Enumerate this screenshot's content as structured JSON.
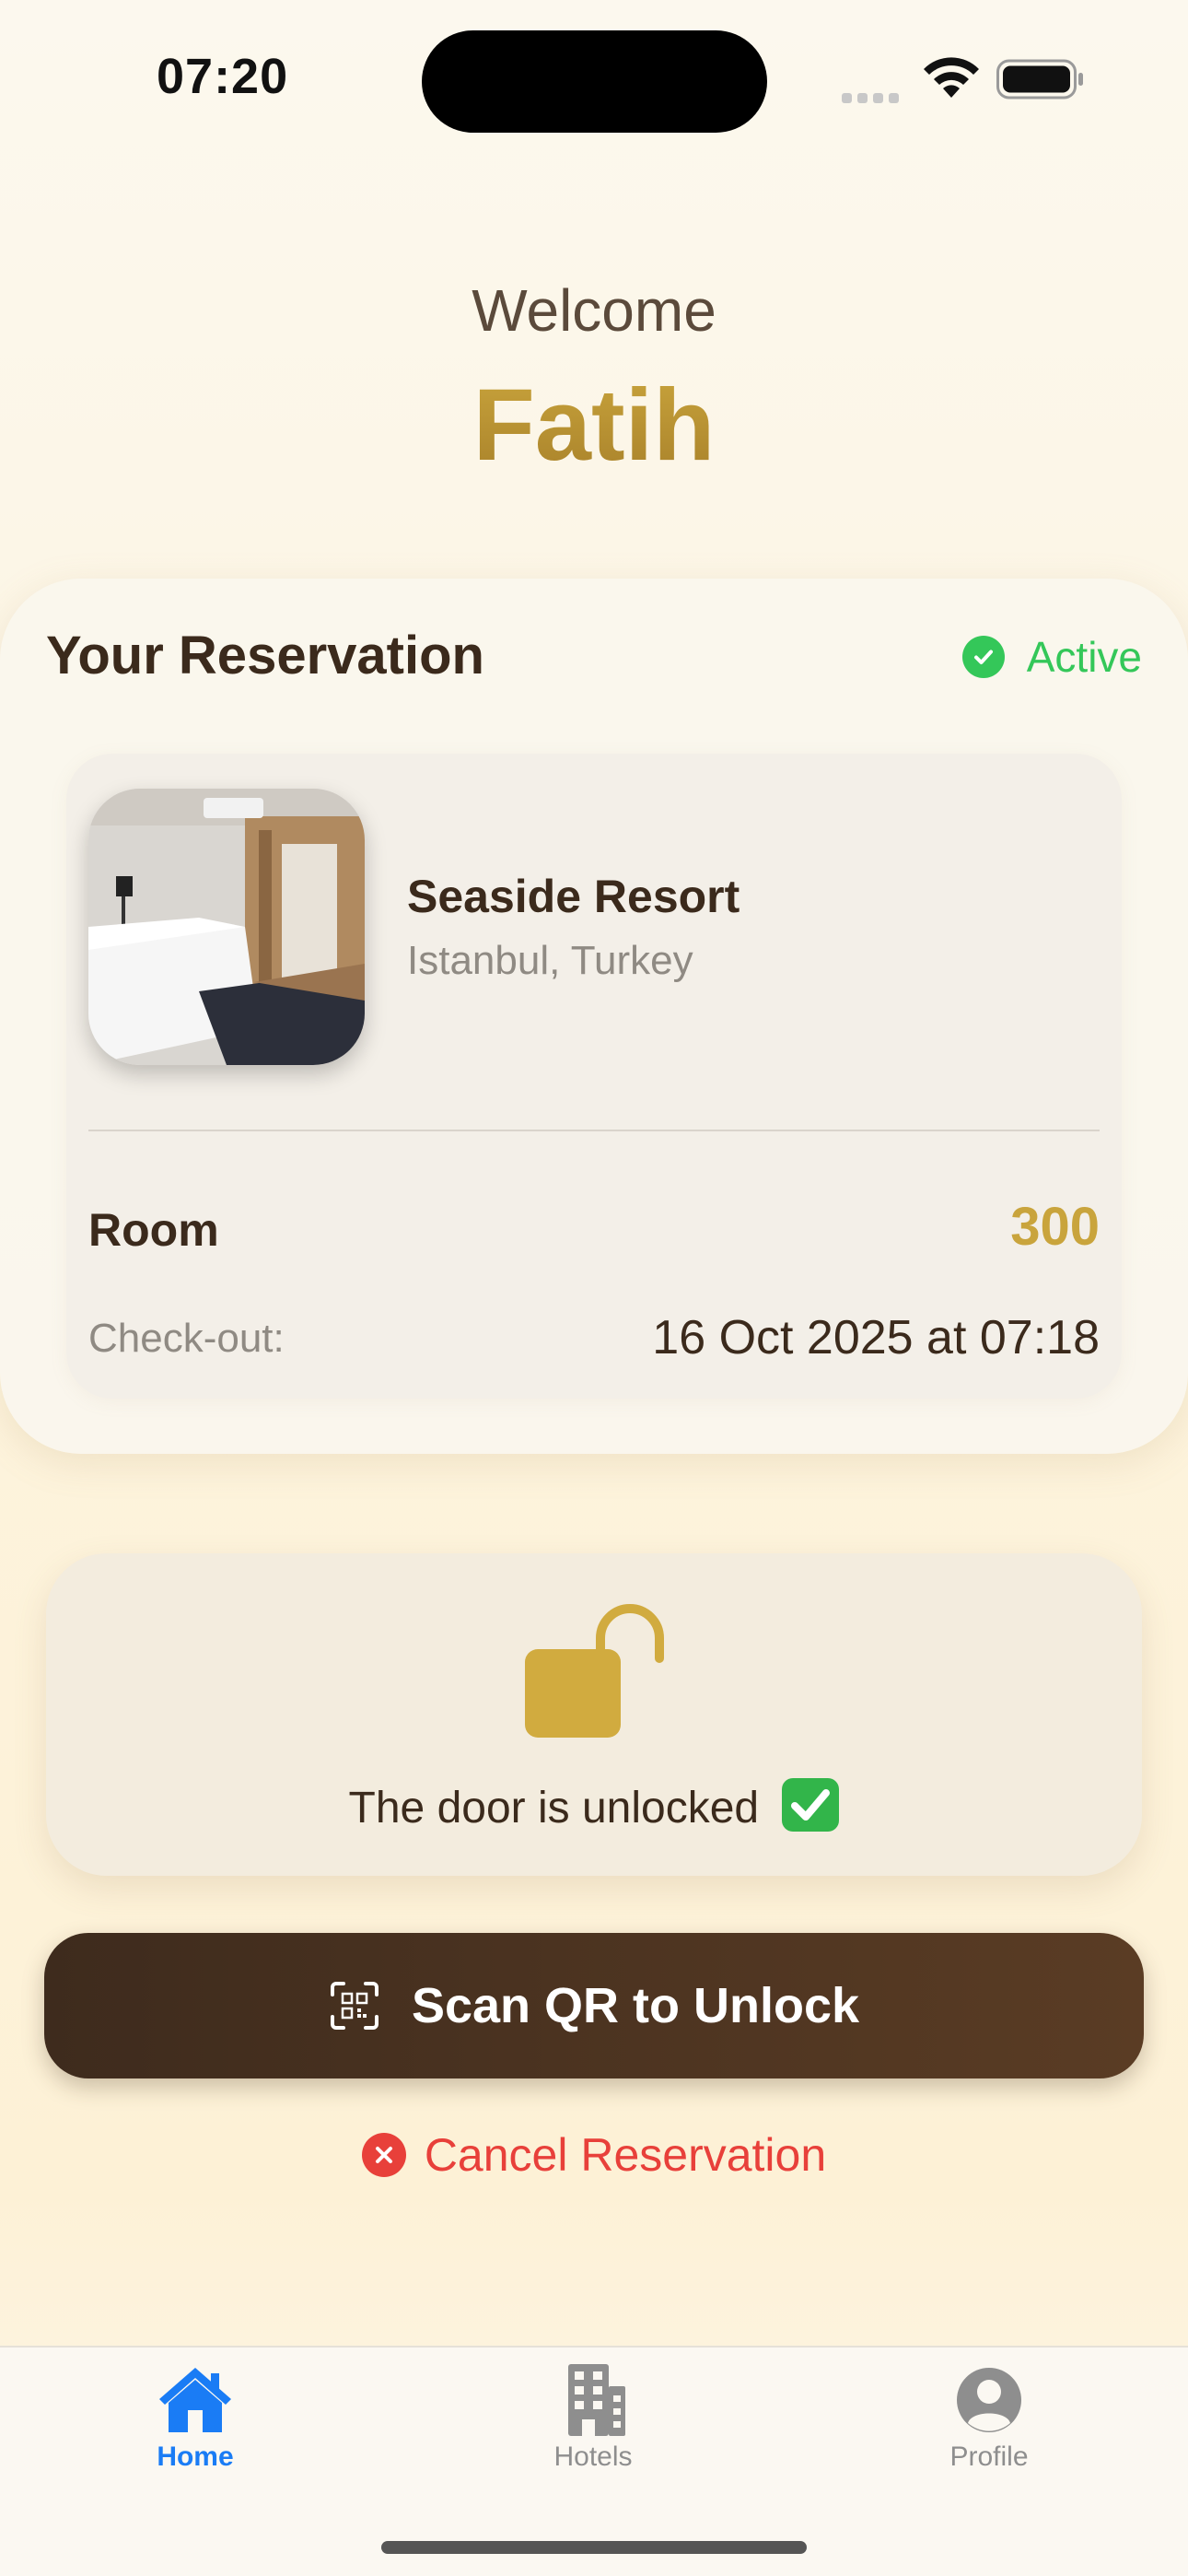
{
  "status_bar": {
    "time": "07:20"
  },
  "welcome": {
    "label": "Welcome",
    "name": "Fatih"
  },
  "reservation": {
    "title": "Your Reservation",
    "status": "Active",
    "hotel_name": "Seaside Resort",
    "location": "Istanbul, Turkey",
    "room_label": "Room",
    "room_value": "300",
    "checkout_label": "Check-out:",
    "checkout_value": "16 Oct 2025 at 07:18"
  },
  "door": {
    "status_text": "The door is unlocked"
  },
  "actions": {
    "scan_label": "Scan QR to Unlock",
    "cancel_label": "Cancel Reservation"
  },
  "tab_bar": {
    "items": [
      {
        "label": "Home",
        "icon": "house-icon",
        "active": true
      },
      {
        "label": "Hotels",
        "icon": "building-icon",
        "active": false
      },
      {
        "label": "Profile",
        "icon": "person-circle-icon",
        "active": false
      }
    ]
  },
  "colors": {
    "accent_gold": "#c9a43c",
    "dark_brown": "#3e2b1d",
    "active_green": "#34c759",
    "cancel_red": "#e8403a",
    "tab_active_blue": "#1a7cf5",
    "tab_inactive_gray": "#8e8e8e"
  }
}
